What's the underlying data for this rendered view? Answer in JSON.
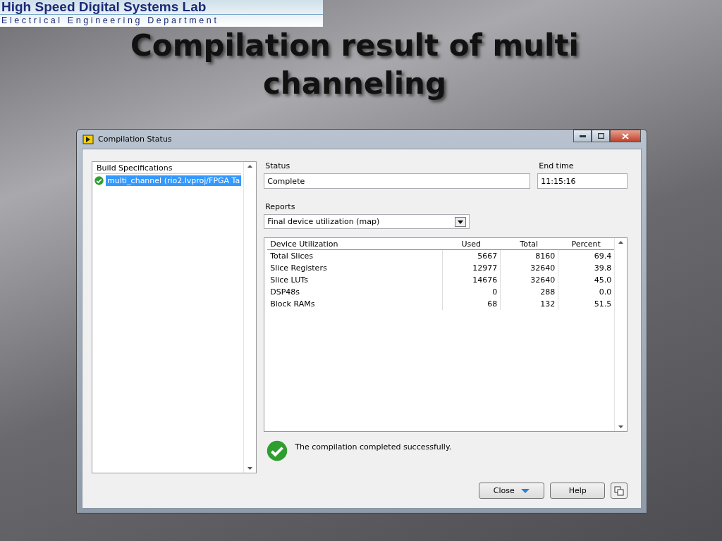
{
  "logo": {
    "title": "High Speed Digital Systems Lab",
    "subtitle": "Electrical Engineering Department"
  },
  "slide_title": "Compilation result of multi channeling",
  "window": {
    "title": "Compilation Status"
  },
  "build_specifications": {
    "header": "Build Specifications",
    "items": [
      {
        "label": "multi_channel (rio2.lvproj/FPGA Ta",
        "selected": true
      }
    ]
  },
  "status": {
    "label": "Status",
    "value": "Complete"
  },
  "end_time": {
    "label": "End time",
    "value": "11:15:16"
  },
  "reports": {
    "label": "Reports",
    "value": "Final device utilization (map)"
  },
  "table": {
    "columns": [
      "Device Utilization",
      "Used",
      "Total",
      "Percent"
    ],
    "rows": [
      [
        "Total Slices",
        "5667",
        "8160",
        "69.4"
      ],
      [
        "Slice Registers",
        "12977",
        "32640",
        "39.8"
      ],
      [
        "Slice LUTs",
        "14676",
        "32640",
        "45.0"
      ],
      [
        "DSP48s",
        "0",
        "288",
        "0.0"
      ],
      [
        "Block RAMs",
        "68",
        "132",
        "51.5"
      ]
    ]
  },
  "message": "The compilation completed successfully.",
  "buttons": [
    "Close",
    "Help"
  ]
}
